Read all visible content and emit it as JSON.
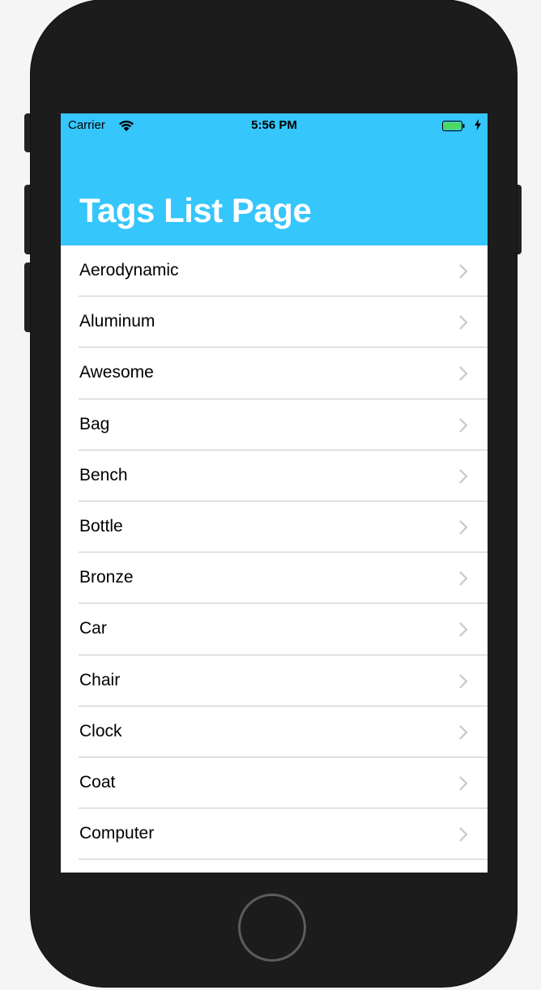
{
  "status_bar": {
    "carrier": "Carrier",
    "time": "5:56 PM",
    "wifi_icon": "wifi-icon",
    "battery_icon": "battery-icon",
    "battery_color": "#4cd964",
    "charge_icon": "charging-bolt-icon"
  },
  "navbar": {
    "title": "Tags List Page",
    "background_color": "#35c6fb",
    "title_color": "#ffffff"
  },
  "list": {
    "chevron_icon": "chevron-right-icon",
    "items": [
      {
        "label": "Aerodynamic"
      },
      {
        "label": "Aluminum"
      },
      {
        "label": "Awesome"
      },
      {
        "label": "Bag"
      },
      {
        "label": "Bench"
      },
      {
        "label": "Bottle"
      },
      {
        "label": "Bronze"
      },
      {
        "label": "Car"
      },
      {
        "label": "Chair"
      },
      {
        "label": "Clock"
      },
      {
        "label": "Coat"
      },
      {
        "label": "Computer"
      }
    ]
  },
  "device": {
    "home_button_icon": "home-button"
  }
}
